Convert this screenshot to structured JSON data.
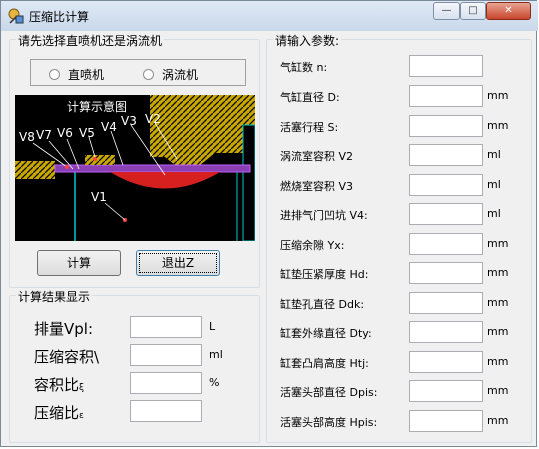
{
  "window": {
    "title": "压缩比计算",
    "minimize": "—",
    "maximize": "□",
    "close": "✕"
  },
  "engine_group": {
    "title": "请先选择直喷机还是涡流机",
    "options": [
      "直喷机",
      "涡流机"
    ]
  },
  "diagram": {
    "title": "计算示意图",
    "labels": [
      "V8",
      "V7",
      "V6",
      "V5",
      "V4",
      "V3",
      "V2",
      "V1"
    ]
  },
  "buttons": {
    "calculate": "计算",
    "exit": "退出Z"
  },
  "results": {
    "title": "计算结果显示",
    "rows": [
      {
        "label": "排量Vpl:",
        "sub": "",
        "unit": "L",
        "value": ""
      },
      {
        "label": "压缩容积\\",
        "sub": "",
        "unit": "ml",
        "value": ""
      },
      {
        "label": "容积比",
        "sub": "ξ",
        "unit": "%",
        "value": ""
      },
      {
        "label": "压缩比",
        "sub": "ε",
        "unit": "",
        "value": ""
      }
    ]
  },
  "params": {
    "title": "请输入参数:",
    "rows": [
      {
        "label": "气缸数 n:",
        "unit": "",
        "value": ""
      },
      {
        "label": "气缸直径 D:",
        "unit": "mm",
        "value": ""
      },
      {
        "label": "活塞行程 S:",
        "unit": "mm",
        "value": ""
      },
      {
        "label": "涡流室容积 V2",
        "unit": "ml",
        "value": ""
      },
      {
        "label": "燃烧室容积 V3",
        "unit": "ml",
        "value": ""
      },
      {
        "label": "进排气门凹坑 V4:",
        "unit": "ml",
        "value": ""
      },
      {
        "label": "压缩余隙 Yx:",
        "unit": "mm",
        "value": ""
      },
      {
        "label": "缸垫压紧厚度 Hd:",
        "unit": "mm",
        "value": ""
      },
      {
        "label": "缸垫孔直径 Ddk:",
        "unit": "mm",
        "value": ""
      },
      {
        "label": "缸套外缘直径 Dty:",
        "unit": "mm",
        "value": ""
      },
      {
        "label": "缸套凸肩高度 Htj:",
        "unit": "mm",
        "value": ""
      },
      {
        "label": "活塞头部直径 Dpis:",
        "unit": "mm",
        "value": ""
      },
      {
        "label": "活塞头部高度 Hpis:",
        "unit": "mm",
        "value": ""
      }
    ]
  }
}
